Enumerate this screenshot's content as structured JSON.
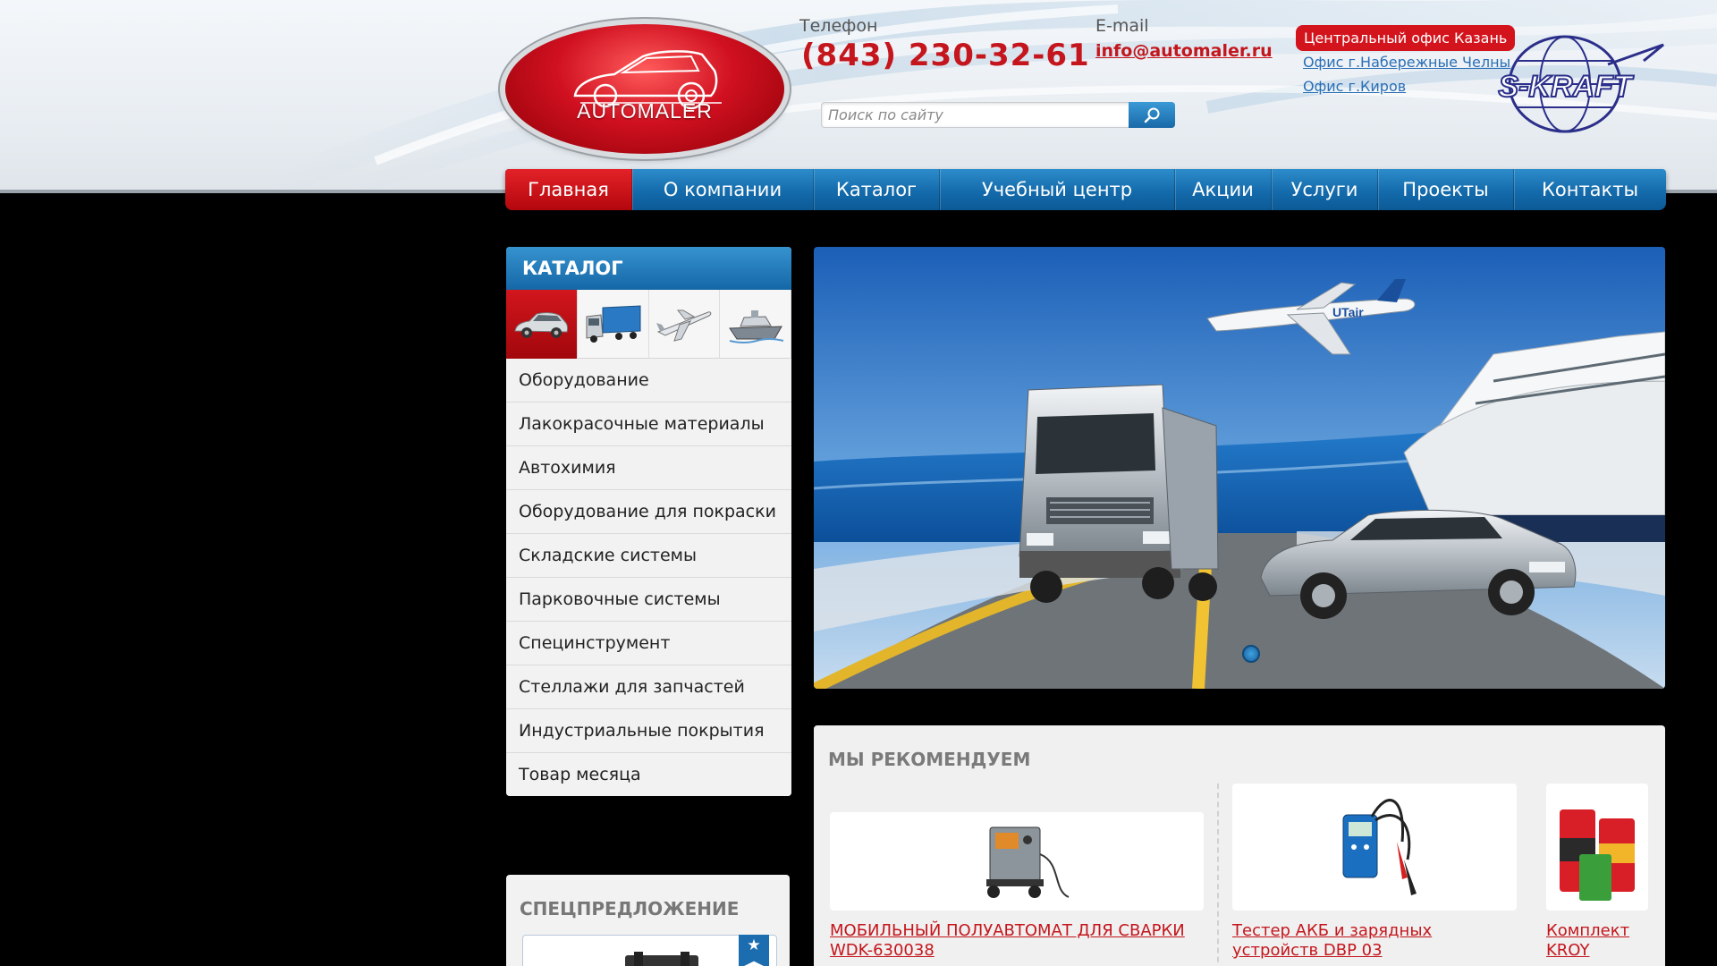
{
  "header": {
    "logo_text": "AUTOMALER",
    "phone_label": "Телефон",
    "phone": "(843) 230-32-61",
    "email_label": "E-mail",
    "email": "info@automaler.ru",
    "search_placeholder": "Поиск по сайту",
    "offices": {
      "main": "Центральный офис Казань",
      "links": [
        "Офис г.Набережные Челны",
        "Офис г.Киров"
      ]
    },
    "partner_logo": "S-KRAFT"
  },
  "nav": {
    "items": [
      "Главная",
      "О компании",
      "Каталог",
      "Учебный центр",
      "Акции",
      "Услуги",
      "Проекты",
      "Контакты"
    ],
    "active": "Главная"
  },
  "catalog": {
    "title": "КАТАЛОГ",
    "icons": [
      "car-icon",
      "truck-icon",
      "airplane-icon",
      "ship-icon"
    ],
    "items": [
      "Оборудование",
      "Лакокрасочные материалы",
      "Автохимия",
      "Оборудование для покраски",
      "Складские системы",
      "Парковочные системы",
      "Специнструмент",
      "Стеллажи для запчастей",
      "Индустриальные покрытия",
      "Товар месяца"
    ]
  },
  "special": {
    "title": "СПЕЦПРЕДЛОЖЕНИЕ"
  },
  "banner": {
    "airline_text": "UTair"
  },
  "recommend": {
    "title": "МЫ РЕКОМЕНДУЕМ",
    "products": [
      "МОБИЛЬНЫЙ ПОЛУАВТОМАТ ДЛЯ СВАРКИ WDK-630038",
      "Тестер АКБ и зарядных устройств DBP 03",
      "Комплект KROY"
    ]
  },
  "colors": {
    "brand_red": "#c4161c",
    "nav_blue": "#146bab",
    "link_blue": "#2a6fb5"
  }
}
